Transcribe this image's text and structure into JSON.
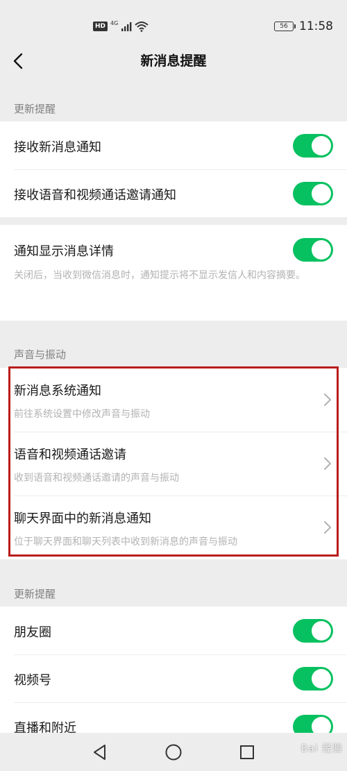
{
  "status_bar": {
    "hd": "HD",
    "net": "4G",
    "battery": "56",
    "time": "11:58"
  },
  "navbar": {
    "title": "新消息提醒"
  },
  "section1": {
    "header": "更新提醒",
    "rows": [
      {
        "label": "接收新消息通知",
        "on": true
      },
      {
        "label": "接收语音和视频通话邀请通知",
        "on": true
      }
    ]
  },
  "section_detail": {
    "label": "通知显示消息详情",
    "on": true,
    "description": "关闭后，当收到微信消息时，通知提示将不显示发信人和内容摘要。"
  },
  "section_sound": {
    "header": "声音与振动",
    "rows": [
      {
        "title": "新消息系统通知",
        "subtitle": "前往系统设置中修改声音与振动"
      },
      {
        "title": "语音和视频通话邀请",
        "subtitle": "收到语音和视频通话邀请的声音与振动"
      },
      {
        "title": "聊天界面中的新消息通知",
        "subtitle": "位于聊天界面和聊天列表中收到新消息的声音与振动"
      }
    ]
  },
  "section2": {
    "header": "更新提醒",
    "rows": [
      {
        "label": "朋友圈",
        "on": true
      },
      {
        "label": "视频号",
        "on": true
      },
      {
        "label": "直播和附近",
        "on": true
      }
    ]
  },
  "watermark": "Bai 经验",
  "colors": {
    "accent": "#07c160",
    "highlight": "#b91c1c",
    "background": "#ededed"
  }
}
